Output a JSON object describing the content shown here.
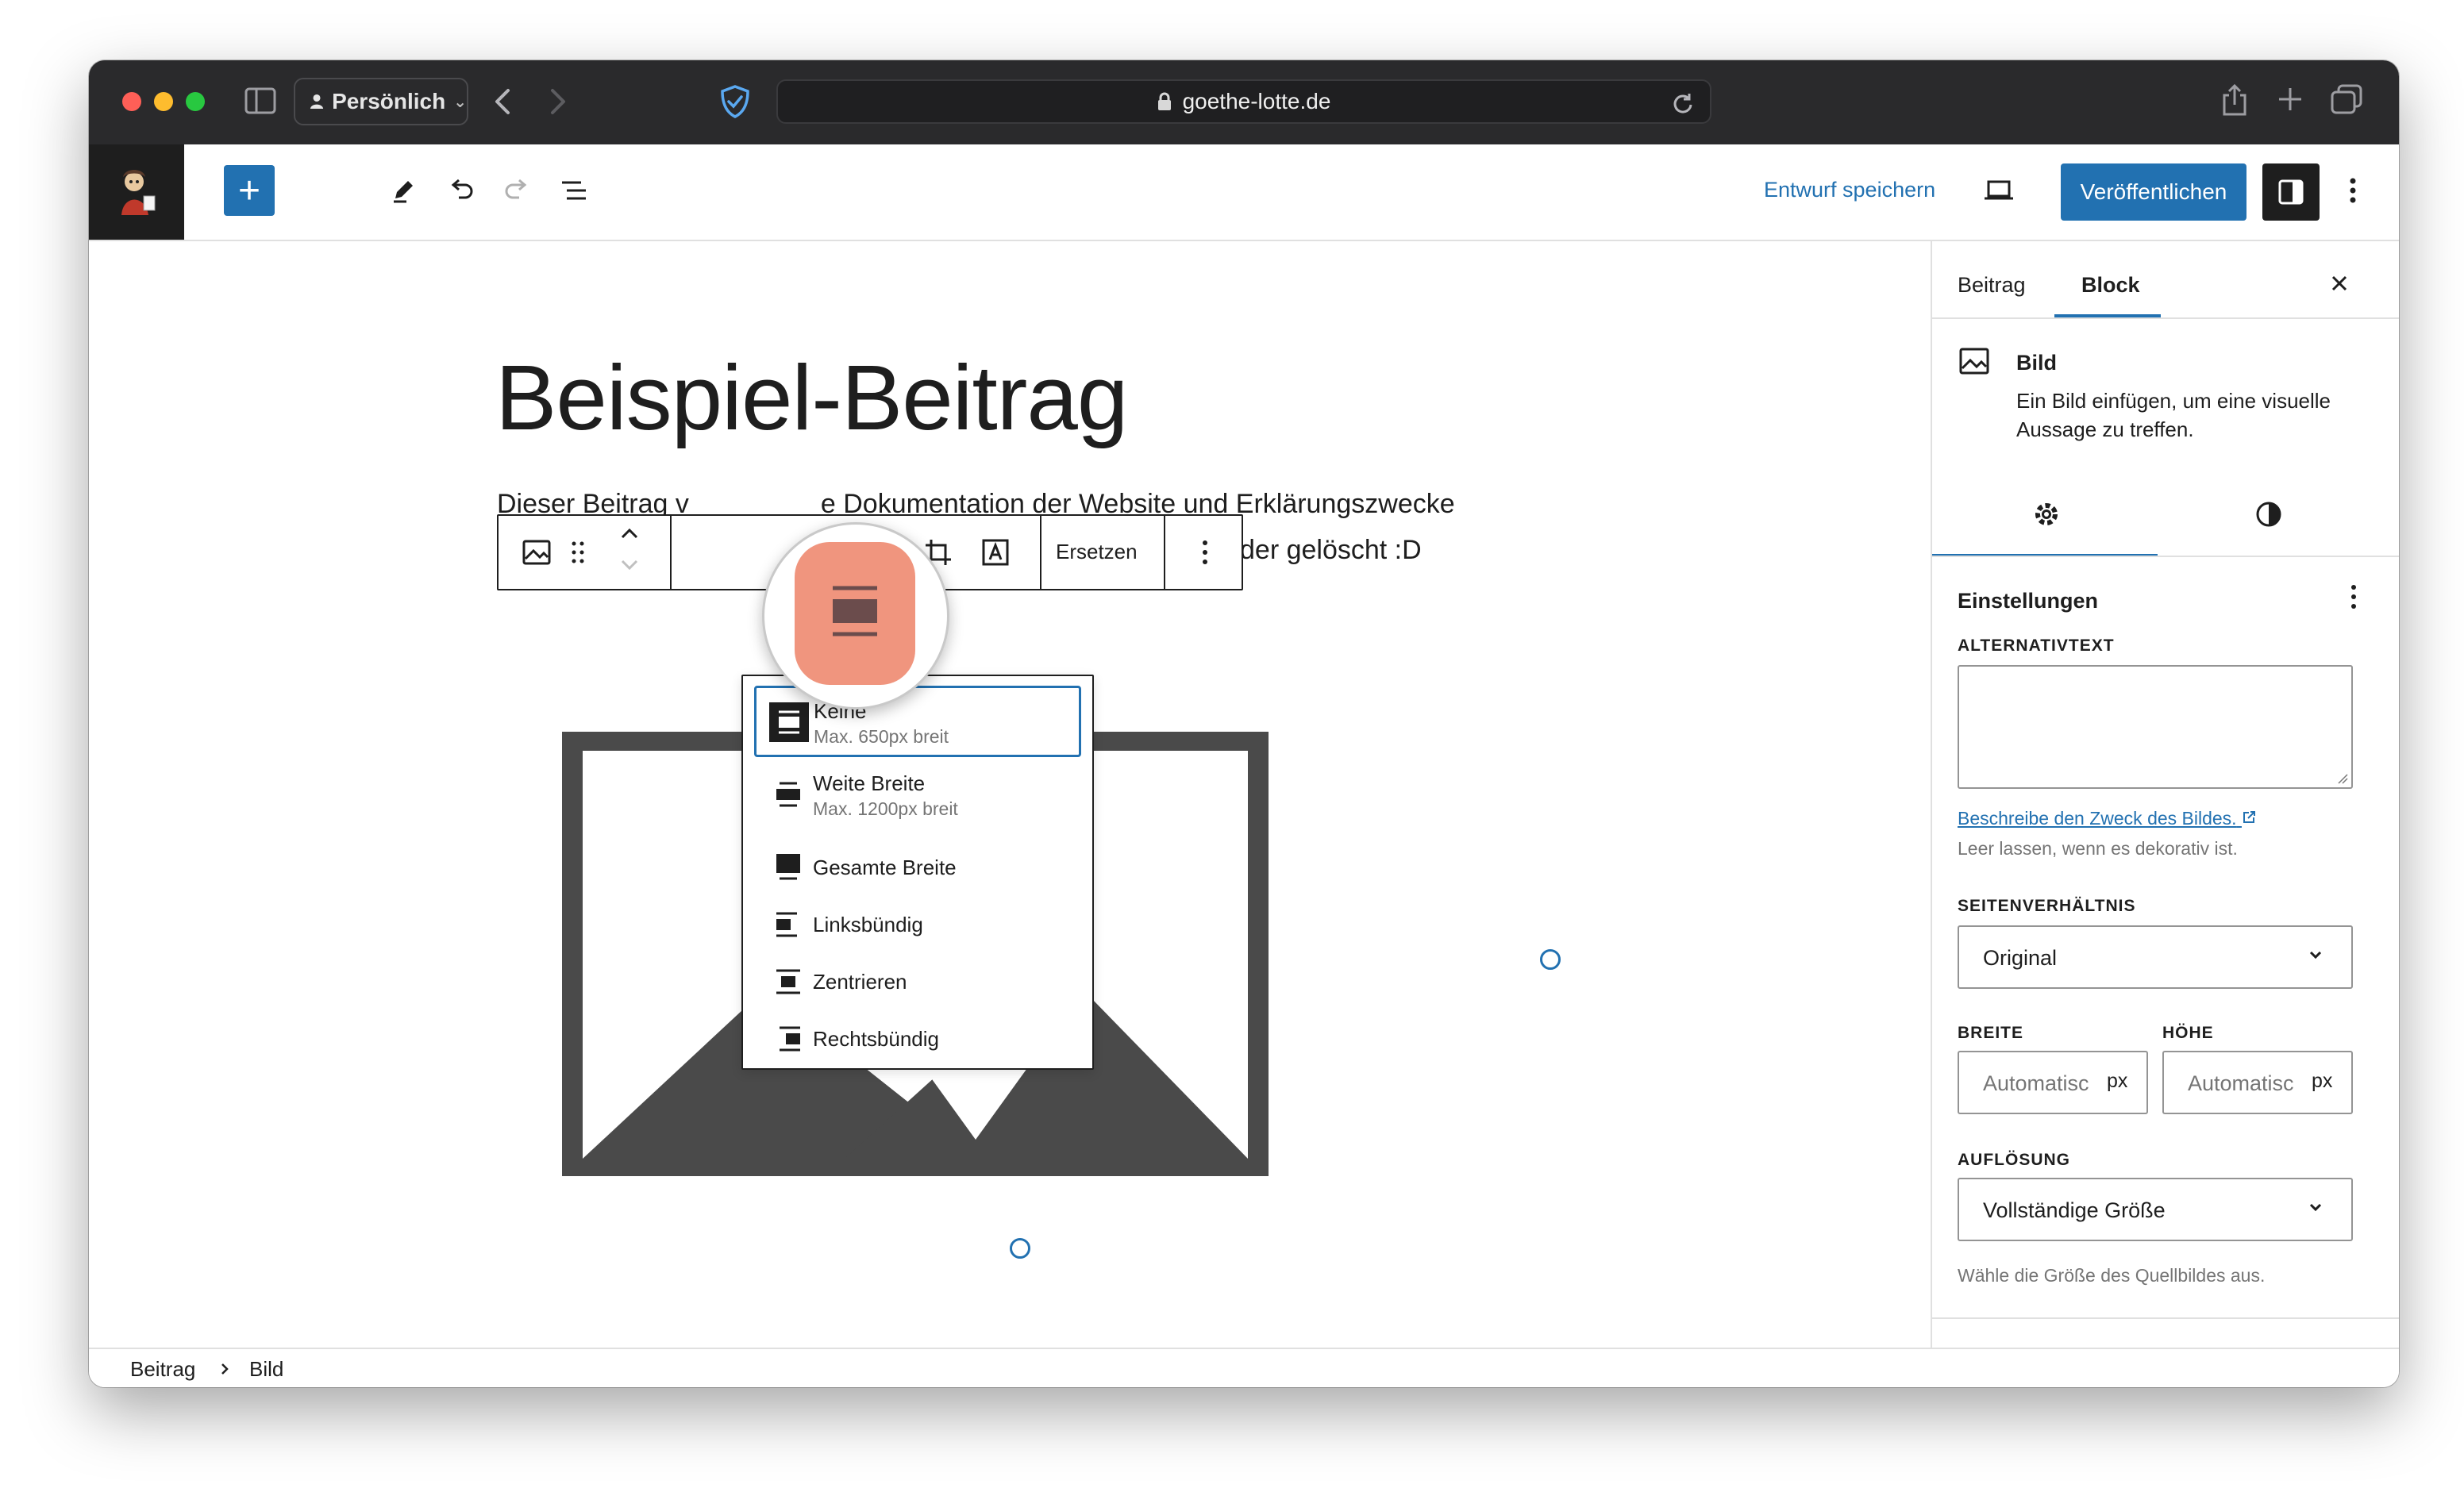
{
  "browser": {
    "profile_label": "Persönlich",
    "url": "goethe-lotte.de"
  },
  "toolbar": {
    "draft_label": "Entwurf speichern",
    "publish_label": "Veröffentlichen"
  },
  "post": {
    "title": "Beispiel-Beitrag",
    "text_line1": "Dieser Beitrag v",
    "text_line1_mid": "e Dokumentation der Website und Erklärungszwecke",
    "text_line2_end": "der gelöscht :D"
  },
  "block_toolbar": {
    "replace_label": "Ersetzen"
  },
  "align_menu": {
    "items": [
      {
        "label": "Keine",
        "sub": "Max. 650px breit"
      },
      {
        "label": "Weite Breite",
        "sub": "Max. 1200px breit"
      },
      {
        "label": "Gesamte Breite"
      },
      {
        "label": "Linksbündig"
      },
      {
        "label": "Zentrieren"
      },
      {
        "label": "Rechtsbündig"
      }
    ]
  },
  "sidebar": {
    "tabs": [
      "Beitrag",
      "Block"
    ],
    "block_name": "Bild",
    "block_desc_1": "Ein Bild einfügen, um eine visuelle",
    "block_desc_2": "Aussage zu treffen.",
    "settings_title": "Einstellungen",
    "alt_label": "ALTERNATIVTEXT",
    "alt_link": "Beschreibe den Zweck des Bildes.",
    "alt_help": "Leer lassen, wenn es dekorativ ist.",
    "aspect_label": "SEITENVERHÄLTNIS",
    "aspect_value": "Original",
    "width_label": "BREITE",
    "height_label": "HÖHE",
    "width_placeholder": "Automatisch",
    "height_placeholder": "Automatisch",
    "unit": "px",
    "resolution_label": "AUFLÖSUNG",
    "resolution_value": "Vollständige Größe",
    "resolution_help": "Wähle die Größe des Quellbildes aus."
  },
  "breadcrumb": {
    "root": "Beitrag",
    "current": "Bild"
  },
  "colors": {
    "accent": "#2271b1",
    "dark": "#1e1e1e",
    "highlight": "#f0957e"
  }
}
